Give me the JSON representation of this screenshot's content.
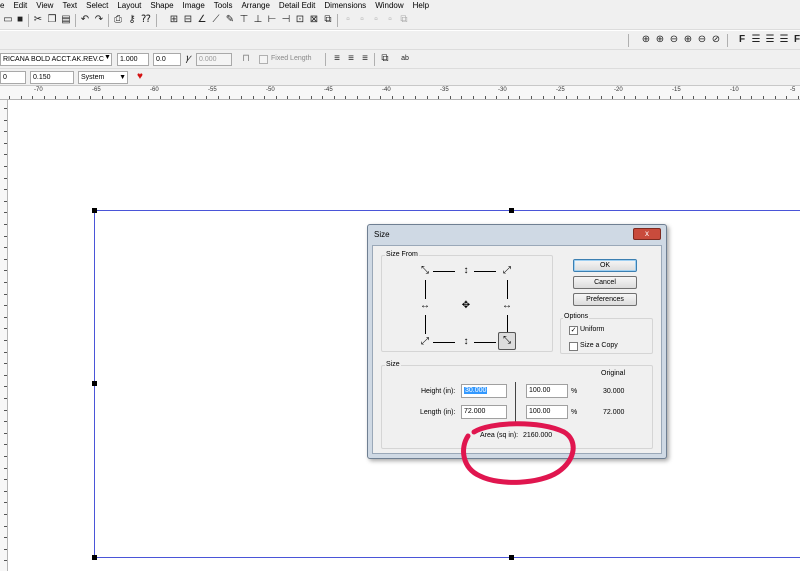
{
  "menu": [
    "e",
    "Edit",
    "View",
    "Text",
    "Select",
    "Layout",
    "Shape",
    "Image",
    "Tools",
    "Arrange",
    "Detail Edit",
    "Dimensions",
    "Window",
    "Help"
  ],
  "toolbar2": {
    "font": "RICANA BOLD ACCT.AK.REV.C",
    "size": "1.000",
    "spacing": "0.0",
    "italic_value": "0.000",
    "fixed_length": "Fixed Length"
  },
  "toolbar3": {
    "value_a": "0",
    "value_b": "0.150",
    "mode": "System"
  },
  "ruler": [
    "-70",
    "-65",
    "-60",
    "-55",
    "-50",
    "-45",
    "-40",
    "-35",
    "-30",
    "-25",
    "-20",
    "-15",
    "-10",
    "-5"
  ],
  "dialog": {
    "title": "Size",
    "close": "x",
    "size_from": "Size From",
    "ok": "OK",
    "cancel": "Cancel",
    "preferences": "Preferences",
    "options": "Options",
    "uniform": "Uniform",
    "size_copy": "Size a Copy",
    "size_group": "Size",
    "original": "Original",
    "height_label": "Height (in):",
    "height_value": "30.000",
    "height_pct": "100.00",
    "height_orig": "30.000",
    "length_label": "Length (in):",
    "length_value": "72.000",
    "length_pct": "100.00",
    "length_orig": "72.000",
    "percent": "%",
    "area_label": "Area (sq in):",
    "area_value": "2160.000"
  },
  "colors": {
    "annotation": "#e0164f",
    "selection": "#4a55d8",
    "heart": "#d41010"
  }
}
